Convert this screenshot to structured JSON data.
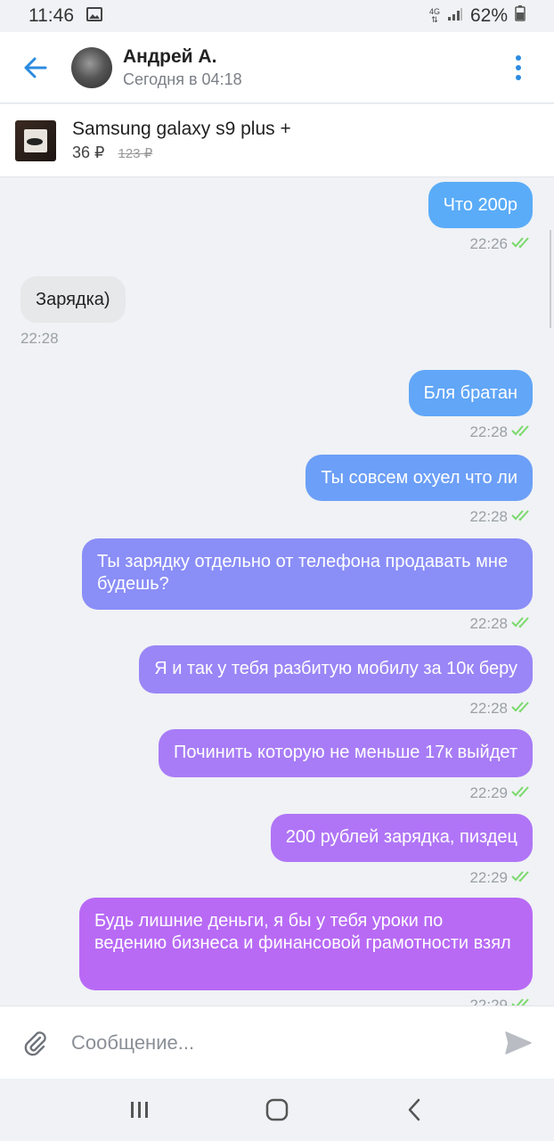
{
  "status_bar": {
    "time": "11:46",
    "network": "4G",
    "battery": "62%"
  },
  "header": {
    "name": "Андрей А.",
    "last_seen": "Сегодня в 04:18"
  },
  "listing": {
    "title": "Samsung galaxy s9 plus +",
    "price": "36 ₽",
    "old_price": "123 ₽"
  },
  "messages": [
    {
      "text": "Что 200р",
      "time": "22:26",
      "dir": "out"
    },
    {
      "text": "Зарядка)",
      "time": "22:28",
      "dir": "in"
    },
    {
      "text": "Бля братан",
      "time": "22:28",
      "dir": "out"
    },
    {
      "text": "Ты совсем охуел что ли",
      "time": "22:28",
      "dir": "out"
    },
    {
      "text": "Ты зарядку отдельно от телефона продавать мне будешь?",
      "time": "22:28",
      "dir": "out"
    },
    {
      "text": "Я и так у тебя разбитую мобилу за 10к беру",
      "time": "22:28",
      "dir": "out"
    },
    {
      "text": "Починить которую не меньше 17к выйдет",
      "time": "22:29",
      "dir": "out"
    },
    {
      "text": "200 рублей зарядка, пиздец",
      "time": "22:29",
      "dir": "out"
    },
    {
      "text": "Будь лишние деньги, я бы у тебя уроки по ведению бизнеса и финансовой грамотности взял",
      "time": "22:29",
      "dir": "out"
    }
  ],
  "composer": {
    "placeholder": "Сообщение..."
  },
  "colors": {
    "accent": "#2b8be0",
    "bubble_blue": "#62aaf7",
    "bubble_purple": "#b86af5",
    "bubble_in": "#e7e8ea",
    "read_check": "#7ad96b"
  }
}
